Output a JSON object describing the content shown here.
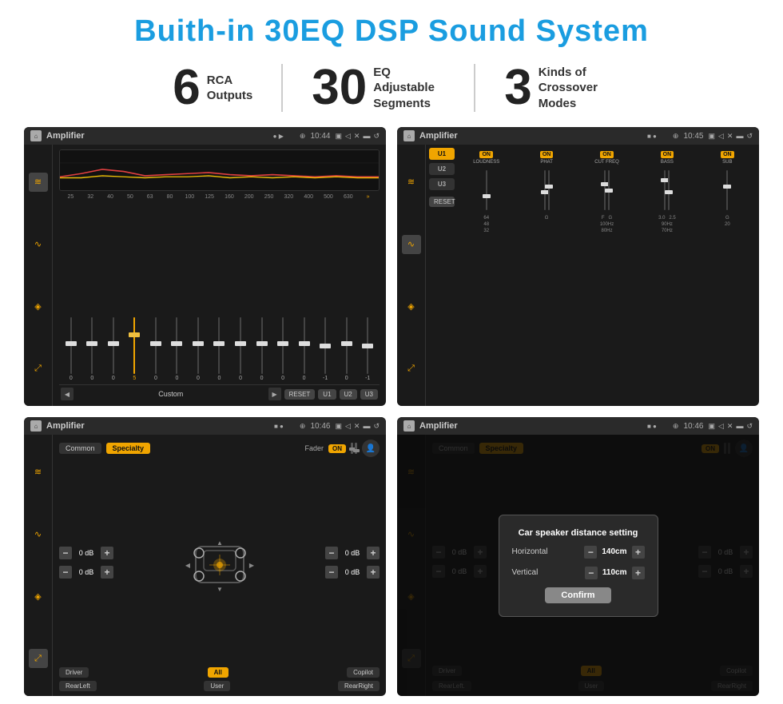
{
  "title": "Buith-in 30EQ DSP Sound System",
  "stats": [
    {
      "number": "6",
      "label": "RCA\nOutputs"
    },
    {
      "number": "30",
      "label": "EQ Adjustable\nSegments"
    },
    {
      "number": "3",
      "label": "Kinds of\nCrossover Modes"
    }
  ],
  "screens": [
    {
      "id": "eq-screen",
      "statusBar": {
        "appTitle": "Amplifier",
        "time": "10:44",
        "dots": "● ▶"
      },
      "type": "eq",
      "freqLabels": [
        "25",
        "32",
        "40",
        "50",
        "63",
        "80",
        "100",
        "125",
        "160",
        "200",
        "250",
        "320",
        "400",
        "500",
        "630"
      ],
      "sliderValues": [
        "0",
        "0",
        "0",
        "5",
        "0",
        "0",
        "0",
        "0",
        "0",
        "0",
        "0",
        "0",
        "-1",
        "0",
        "-1"
      ],
      "preset": "Custom",
      "buttons": [
        "RESET",
        "U1",
        "U2",
        "U3"
      ]
    },
    {
      "id": "crossover-screen",
      "statusBar": {
        "appTitle": "Amplifier",
        "time": "10:45",
        "dots": "■ ●"
      },
      "type": "crossover",
      "presets": [
        "U1",
        "U2",
        "U3"
      ],
      "channels": [
        {
          "name": "LOUDNESS",
          "on": true
        },
        {
          "name": "PHAT",
          "on": true
        },
        {
          "name": "CUT FREQ",
          "on": true
        },
        {
          "name": "BASS",
          "on": true
        },
        {
          "name": "SUB",
          "on": true
        }
      ],
      "resetLabel": "RESET"
    },
    {
      "id": "fader-screen",
      "statusBar": {
        "appTitle": "Amplifier",
        "time": "10:46",
        "dots": "■ ●"
      },
      "type": "fader",
      "tabs": [
        "Common",
        "Specialty"
      ],
      "faderLabel": "Fader",
      "controls": {
        "topLeft": "0 dB",
        "bottomLeft": "0 dB",
        "topRight": "0 dB",
        "bottomRight": "0 dB"
      },
      "bottomBtns": [
        "Driver",
        "",
        "All",
        "",
        "",
        "User",
        "RearRight"
      ],
      "driverLabel": "Driver",
      "allLabel": "All",
      "copilotLabel": "Copilot",
      "rearLeftLabel": "RearLeft",
      "rearRightLabel": "RearRight",
      "userLabel": "User"
    },
    {
      "id": "dialog-screen",
      "statusBar": {
        "appTitle": "Amplifier",
        "time": "10:46",
        "dots": "■ ●"
      },
      "type": "dialog",
      "tabs": [
        "Common",
        "Specialty"
      ],
      "dialog": {
        "title": "Car speaker distance setting",
        "horizontal": {
          "label": "Horizontal",
          "value": "140cm"
        },
        "vertical": {
          "label": "Vertical",
          "value": "110cm"
        },
        "confirmLabel": "Confirm"
      },
      "driverLabel": "Driver",
      "allLabel": "All",
      "copilotLabel": "Copilot",
      "rearLeftLabel": "RearLeft.",
      "rearRightLabel": "RearRight",
      "userLabel": "User"
    }
  ]
}
